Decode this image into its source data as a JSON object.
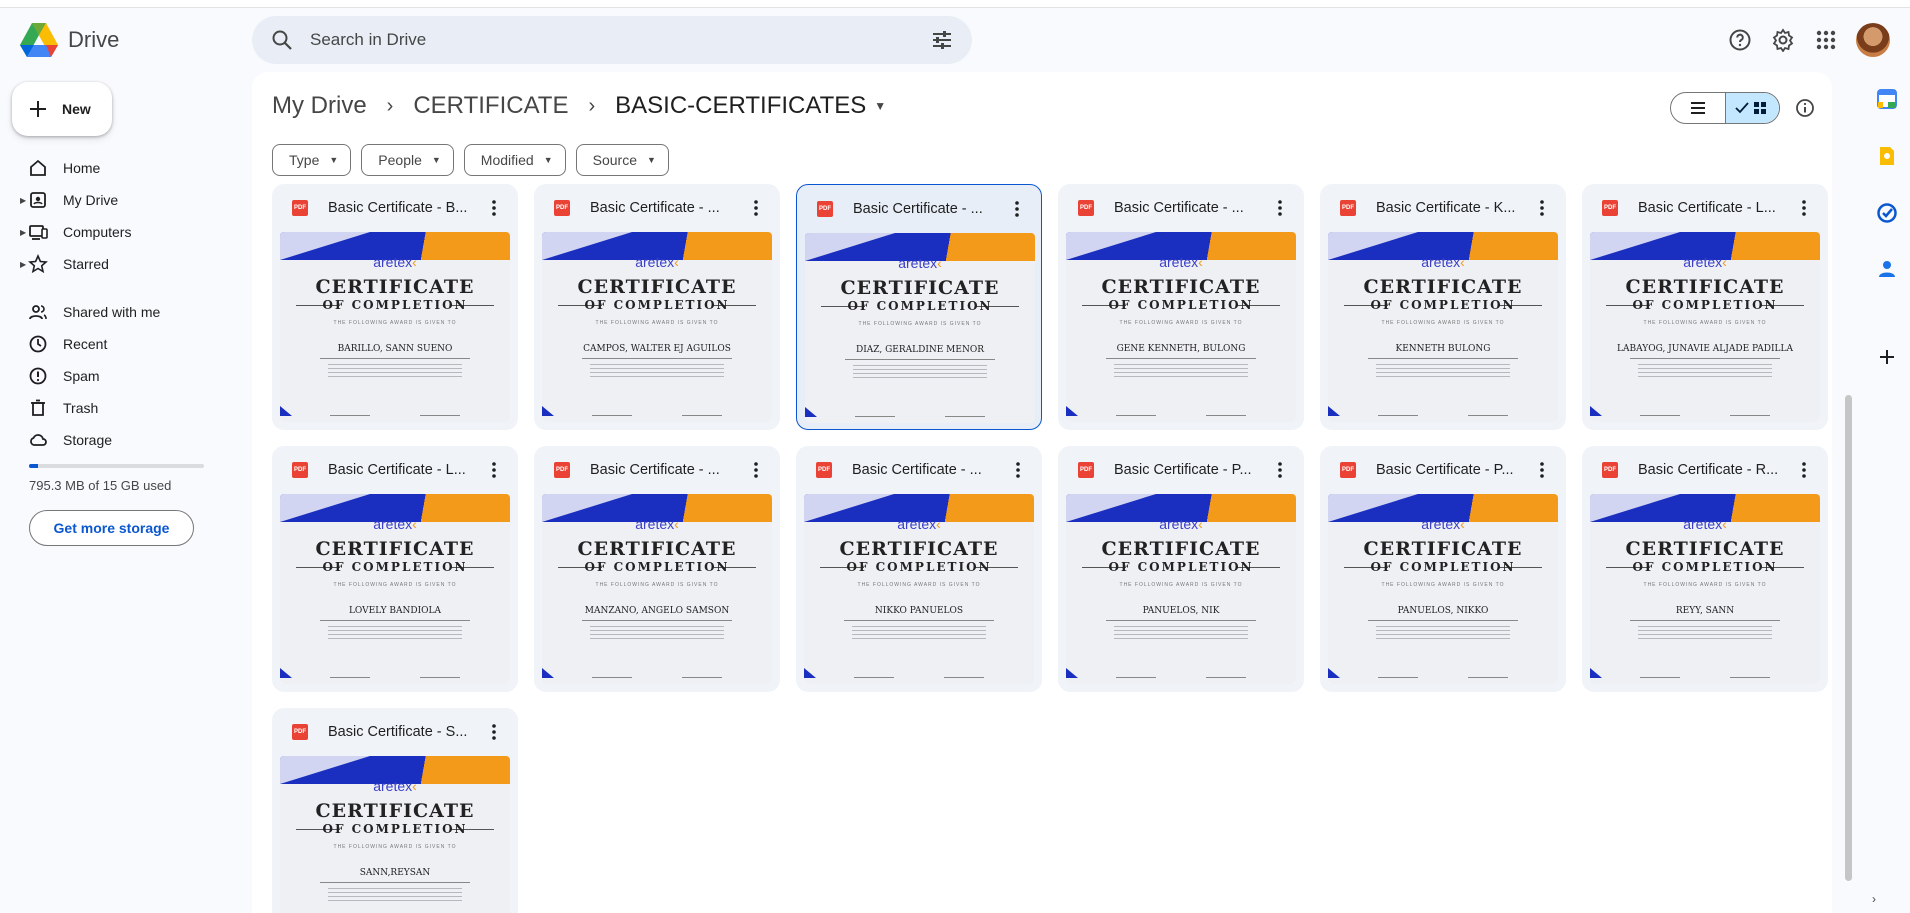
{
  "app": {
    "name": "Drive"
  },
  "search": {
    "placeholder": "Search in Drive"
  },
  "header_icons": [
    "help-icon",
    "settings-icon",
    "apps-icon",
    "avatar"
  ],
  "sidebar": {
    "new_label": "New",
    "items": [
      {
        "label": "Home",
        "icon": "home-icon",
        "expandable": false
      },
      {
        "label": "My Drive",
        "icon": "my-drive-icon",
        "expandable": true
      },
      {
        "label": "Computers",
        "icon": "computers-icon",
        "expandable": true
      },
      {
        "label": "Starred",
        "icon": "star-icon",
        "expandable": true
      },
      {
        "label": "Shared with me",
        "icon": "shared-icon",
        "expandable": false
      },
      {
        "label": "Recent",
        "icon": "clock-icon",
        "expandable": false
      },
      {
        "label": "Spam",
        "icon": "spam-icon",
        "expandable": false
      },
      {
        "label": "Trash",
        "icon": "trash-icon",
        "expandable": false
      },
      {
        "label": "Storage",
        "icon": "cloud-icon",
        "expandable": false
      }
    ],
    "storage_used_text": "795.3 MB of 15 GB used",
    "storage_fraction": 0.053,
    "get_storage_label": "Get more storage"
  },
  "breadcrumb": {
    "items": [
      "My Drive",
      "CERTIFICATE",
      "BASIC-CERTIFICATES"
    ]
  },
  "filters": [
    "Type",
    "People",
    "Modified",
    "Source"
  ],
  "view": {
    "mode": "grid"
  },
  "files": [
    {
      "name": "Basic Certificate - B...",
      "recipient": "BARILLO, SANN SUENO",
      "selected": false
    },
    {
      "name": "Basic Certificate - ...",
      "recipient": "CAMPOS, WALTER EJ AGUILOS",
      "selected": false
    },
    {
      "name": "Basic Certificate - ...",
      "recipient": "DIAZ, GERALDINE MENOR",
      "selected": true
    },
    {
      "name": "Basic Certificate - ...",
      "recipient": "GENE KENNETH, BULONG",
      "selected": false
    },
    {
      "name": "Basic Certificate - K...",
      "recipient": "KENNETH BULONG",
      "selected": false
    },
    {
      "name": "Basic Certificate - L...",
      "recipient": "LABAYOG, JUNAVIE ALJADE PADILLA",
      "selected": false
    },
    {
      "name": "Basic Certificate - L...",
      "recipient": "LOVELY BANDIOLA",
      "selected": false
    },
    {
      "name": "Basic Certificate - ...",
      "recipient": "MANZANO, ANGELO SAMSON",
      "selected": false
    },
    {
      "name": "Basic Certificate - ...",
      "recipient": "NIKKO PANUELOS",
      "selected": false
    },
    {
      "name": "Basic Certificate - P...",
      "recipient": "PANUELOS, NIK",
      "selected": false
    },
    {
      "name": "Basic Certificate - P...",
      "recipient": "PANUELOS, NIKKO",
      "selected": false
    },
    {
      "name": "Basic Certificate - R...",
      "recipient": "REYY, SANN",
      "selected": false
    },
    {
      "name": "Basic Certificate - S...",
      "recipient": "SANN,REYSAN",
      "selected": false
    }
  ],
  "thumbnail": {
    "brand": "aretex",
    "title_line1": "CERTIFICATE",
    "title_line2": "OF COMPLETION",
    "subtitle": "THE FOLLOWING AWARD IS GIVEN TO"
  },
  "file_type_badge": "PDF",
  "colors": {
    "accent": "#0b57d0",
    "pdf": "#ea4335",
    "selected_bg": "#c2e7ff",
    "brand_blue": "#1a2fbf",
    "brand_orange": "#f39a1b"
  },
  "right_rail": [
    "calendar-icon",
    "keep-icon",
    "tasks-icon",
    "contacts-icon",
    "add-icon"
  ]
}
